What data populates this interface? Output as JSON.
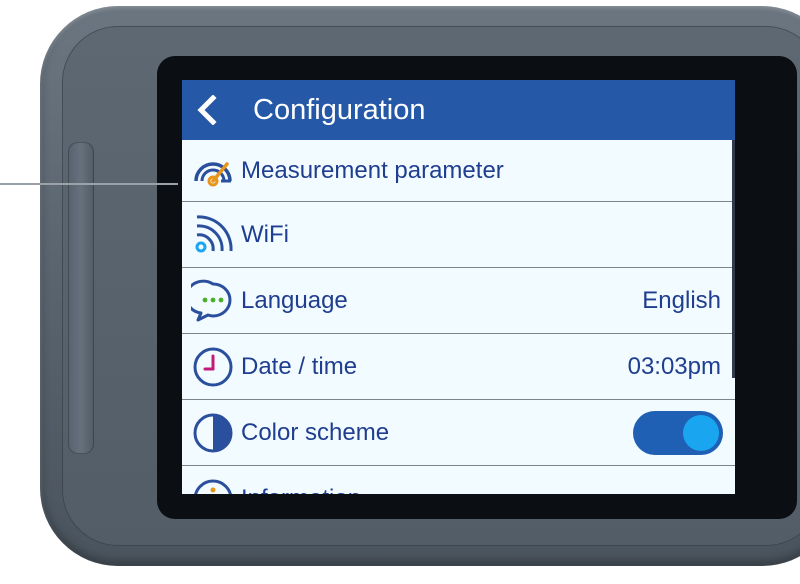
{
  "header": {
    "title": "Configuration"
  },
  "menu": {
    "items": [
      {
        "label": "Measurement parameter",
        "icon": "gauge-icon"
      },
      {
        "label": "WiFi",
        "icon": "wifi-icon"
      },
      {
        "label": "Language",
        "value": "English",
        "icon": "speech-bubble-icon"
      },
      {
        "label": "Date / time",
        "value": "03:03pm",
        "icon": "clock-icon"
      },
      {
        "label": "Color scheme",
        "icon": "contrast-icon",
        "toggle_on": true
      },
      {
        "label": "Information",
        "icon": "info-icon"
      }
    ]
  },
  "colors": {
    "header_bg": "#2559a8",
    "screen_bg": "#f2fbff",
    "text": "#1f3e8f",
    "accent_orange": "#e8951b",
    "accent_green": "#4caf2b",
    "accent_magenta": "#c3197b",
    "toggle_track": "#1f5fb4",
    "toggle_knob": "#1aa5f1"
  }
}
